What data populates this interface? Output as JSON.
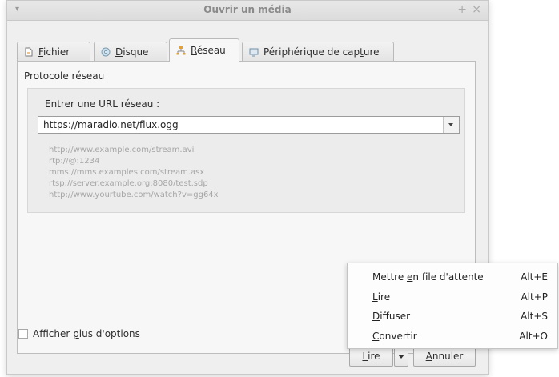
{
  "window": {
    "title": "Ouvrir un média",
    "menu_glyph": "▾",
    "plus_glyph": "+",
    "close_glyph": "×"
  },
  "tabs": [
    {
      "pre": "",
      "ul": "F",
      "post": "ichier",
      "icon": "file-icon"
    },
    {
      "pre": "",
      "ul": "D",
      "post": "isque",
      "icon": "disc-icon"
    },
    {
      "pre": "",
      "ul": "R",
      "post": "éseau",
      "icon": "network-icon"
    },
    {
      "pre": "Périphérique de cap",
      "ul": "t",
      "post": "ure",
      "icon": "capture-device-icon"
    }
  ],
  "network": {
    "group_label": "Protocole réseau",
    "url_label": "Entrer une URL réseau :",
    "url_value": "https://maradio.net/flux.ogg",
    "examples": [
      "http://www.example.com/stream.avi",
      "rtp://@:1234",
      "mms://mms.examples.com/stream.asx",
      "rtsp://server.example.org:8080/test.sdp",
      "http://www.yourtube.com/watch?v=gg64x"
    ]
  },
  "more_options": {
    "pre": "Afficher ",
    "ul": "p",
    "post": "lus d'options",
    "checked": false
  },
  "buttons": {
    "play": {
      "pre": "",
      "ul": "L",
      "post": "ire"
    },
    "cancel": {
      "pre": "",
      "ul": "A",
      "post": "nnuler"
    }
  },
  "play_menu": [
    {
      "pre": "Mettre ",
      "ul": "e",
      "post": "n file d'attente",
      "shortcut": "Alt+E"
    },
    {
      "pre": "",
      "ul": "L",
      "post": "ire",
      "shortcut": "Alt+P"
    },
    {
      "pre": "",
      "ul": "D",
      "post": "iffuser",
      "shortcut": "Alt+S"
    },
    {
      "pre": "",
      "ul": "C",
      "post": "onvertir",
      "shortcut": "Alt+O"
    }
  ],
  "colors": {
    "window_bg": "#efefef",
    "panel_bg": "#f7f7f7",
    "example_text": "#a6a6a6"
  }
}
